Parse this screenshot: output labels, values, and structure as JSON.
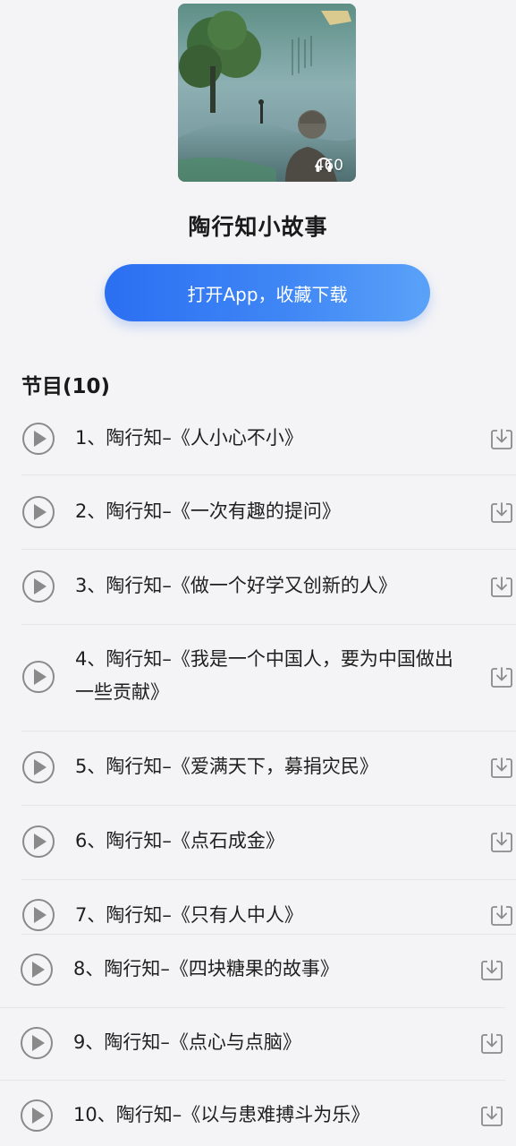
{
  "album": {
    "play_count": "460",
    "title": "陶行知小故事",
    "cover_icon": "headphones-icon"
  },
  "open_app_button": {
    "label": "打开App，收藏下载"
  },
  "program_section": {
    "title": "节目(10)"
  },
  "episodes": [
    {
      "title": "1、陶行知–《人小心不小》"
    },
    {
      "title": "2、陶行知–《一次有趣的提问》"
    },
    {
      "title": "3、陶行知–《做一个好学又创新的人》"
    },
    {
      "title": "4、陶行知–《我是一个中国人，要为中国做出一些贡献》"
    },
    {
      "title": "5、陶行知–《爱满天下，募捐灾民》"
    },
    {
      "title": "6、陶行知–《点石成金》"
    },
    {
      "title": "7、陶行知–《只有人中人》"
    },
    {
      "title": "8、陶行知–《四块糖果的故事》"
    },
    {
      "title": "9、陶行知–《点心与点脑》"
    },
    {
      "title": "10、陶行知–《以与患难搏斗为乐》"
    }
  ],
  "colors": {
    "accent_blue": "#2b6ff2",
    "background": "#f4f4f6",
    "icon_gray": "#8a8a8a"
  }
}
